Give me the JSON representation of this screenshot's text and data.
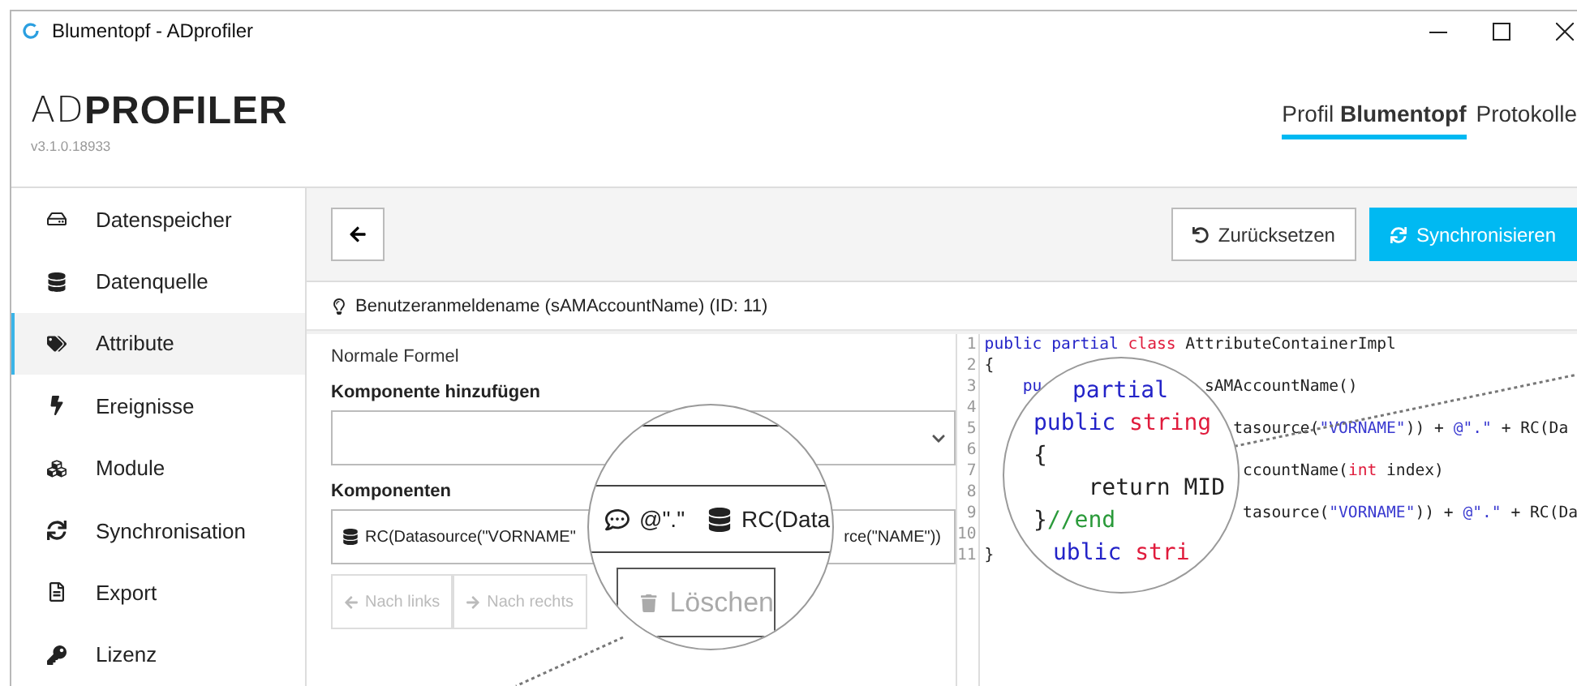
{
  "window": {
    "title": "Blumentopf - ADprofiler"
  },
  "header": {
    "logo_light": "AD",
    "logo_bold": "PROFILER",
    "version": "v3.1.0.18933",
    "tabs": [
      {
        "label": "Profil **Blumentopf**",
        "selected": true
      },
      {
        "label": "Protokolle",
        "selected": false
      }
    ]
  },
  "sidebar": {
    "items": [
      {
        "label": "Datenspeicher",
        "selected": false
      },
      {
        "label": "Datenquelle",
        "selected": false
      },
      {
        "label": "Attribute",
        "selected": true
      },
      {
        "label": "Ereignisse",
        "selected": false
      },
      {
        "label": "Module",
        "selected": false
      },
      {
        "label": "Synchronisation",
        "selected": false
      },
      {
        "label": "Export",
        "selected": false
      },
      {
        "label": "Lizenz",
        "selected": false
      }
    ]
  },
  "toolbar": {
    "buttons": [
      {
        "label": "Zurücksetzen",
        "kind": "secondary"
      },
      {
        "label": "Synchronisieren",
        "kind": "primary"
      }
    ]
  },
  "attribute": {
    "title": "Benutzeranmeldename (sAMAccountName) (ID: 11)"
  },
  "form": {
    "mode": "Normale Formel",
    "add_label": "Komponente hinzufügen",
    "components_label": "Komponenten",
    "components_left": "RC(Datasource(\"VORNAME\"",
    "components_right": "rce(\"NAME\"))",
    "buttons": [
      {
        "label": "Nach links",
        "disabled": true
      },
      {
        "label": "Nach rechts",
        "disabled": true
      }
    ]
  },
  "code": {
    "lines": [
      {
        "number": "1",
        "before": [
          {
            "text": "public ",
            "kind": "keyword"
          },
          {
            "text": "partial ",
            "kind": "keyword"
          },
          {
            "text": "class",
            "kind": "type"
          },
          {
            "text": " AttributeContainerImpl",
            "kind": "plain"
          }
        ]
      },
      {
        "number": "2",
        "before": [
          {
            "text": "{",
            "kind": "plain"
          }
        ]
      },
      {
        "number": "3",
        "before": [
          {
            "text": "    pu",
            "kind": "keyword"
          }
        ],
        "after": [
          {
            "text": "sAMAccountName()",
            "kind": "plain"
          }
        ]
      },
      {
        "number": "4"
      },
      {
        "number": "5",
        "after": [
          {
            "text": "tasource(",
            "kind": "plain"
          },
          {
            "text": "\"VORNAME\"",
            "kind": "string"
          },
          {
            "text": ")) + ",
            "kind": "plain"
          },
          {
            "text": "@\".\"",
            "kind": "string"
          },
          {
            "text": " + RC(Da",
            "kind": "plain"
          }
        ]
      },
      {
        "number": "6"
      },
      {
        "number": "7",
        "after": [
          {
            "text": "ccountName(",
            "kind": "plain"
          },
          {
            "text": "int",
            "kind": "type"
          },
          {
            "text": " index)",
            "kind": "plain"
          }
        ]
      },
      {
        "number": "8"
      },
      {
        "number": "9",
        "after": [
          {
            "text": "tasource(",
            "kind": "plain"
          },
          {
            "text": "\"VORNAME\"",
            "kind": "string"
          },
          {
            "text": ")) + ",
            "kind": "plain"
          },
          {
            "text": "@\".\"",
            "kind": "string"
          },
          {
            "text": " + RC(Da",
            "kind": "plain"
          }
        ]
      },
      {
        "number": "10"
      },
      {
        "number": "11",
        "before": [
          {
            "text": "}",
            "kind": "plain"
          }
        ]
      }
    ]
  },
  "magnifiers": [
    {
      "kind": "form",
      "chip": "@\".\"",
      "component": "RC(Data",
      "button": "Löschen"
    },
    {
      "kind": "code",
      "lines": [
        {
          "tokens": [
            {
              "text": "partial",
              "kind": "keyword"
            }
          ]
        },
        {
          "tokens": [
            {
              "text": "public ",
              "kind": "keyword"
            },
            {
              "text": "string",
              "kind": "type"
            }
          ]
        },
        {
          "tokens": [
            {
              "text": "{",
              "kind": "plain"
            }
          ]
        },
        {
          "tokens": [
            {
              "text": "    return MID",
              "kind": "plain"
            }
          ]
        },
        {
          "tokens": [
            {
              "text": "}",
              "kind": "plain"
            },
            {
              "text": "//end",
              "kind": "comment"
            }
          ]
        },
        {
          "tokens": [
            {
              "text": "ublic ",
              "kind": "keyword"
            },
            {
              "text": "stri",
              "kind": "type"
            }
          ]
        }
      ]
    }
  ]
}
